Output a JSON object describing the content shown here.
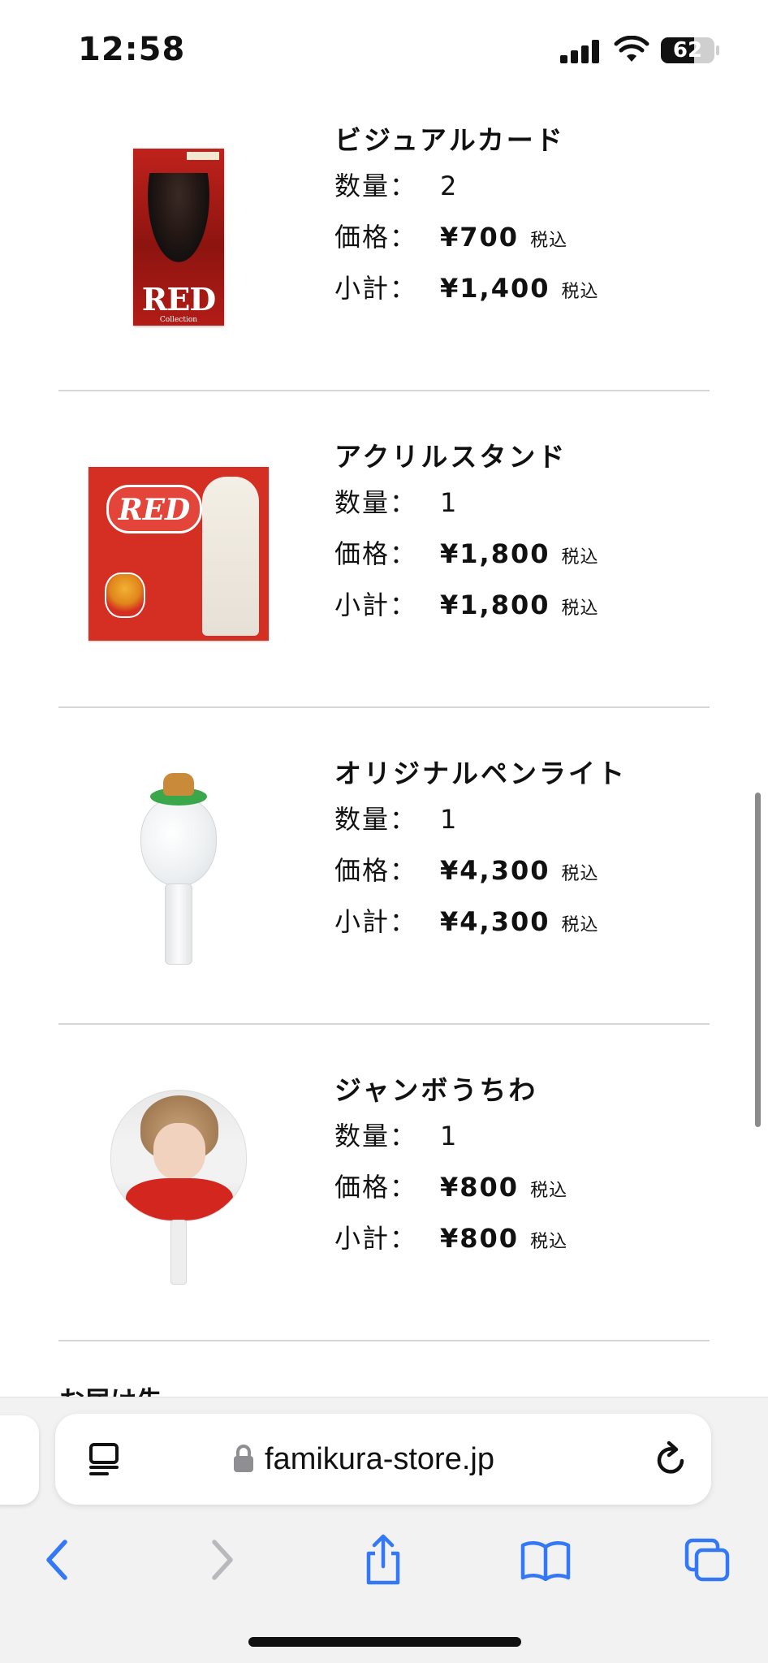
{
  "status_bar": {
    "time": "12:58",
    "battery": "62",
    "battery_level": 0.62,
    "icons": [
      "signal-icon",
      "wifi-icon",
      "battery-icon"
    ]
  },
  "labels": {
    "quantity": "数量：",
    "price": "価格：",
    "subtotal": "小計：",
    "tax_included": "税込"
  },
  "cart": {
    "items": [
      {
        "name": "ビジュアルカード",
        "quantity": "2",
        "price": "¥700",
        "subtotal": "¥1,400",
        "image": {
          "title": "RED",
          "subtitle": "Collection"
        }
      },
      {
        "name": "アクリルスタンド",
        "quantity": "1",
        "price": "¥1,800",
        "subtotal": "¥1,800",
        "image": {
          "title": "RED"
        }
      },
      {
        "name": "オリジナルペンライト",
        "quantity": "1",
        "price": "¥4,300",
        "subtotal": "¥4,300"
      },
      {
        "name": "ジャンボうちわ",
        "quantity": "1",
        "price": "¥800",
        "subtotal": "¥800"
      }
    ],
    "next_section_heading_partial": "お届け先"
  },
  "browser": {
    "url": "famikura-store.jp",
    "icons": {
      "reader": "reader-icon",
      "lock": "lock-icon",
      "reload": "reload-icon",
      "back": "back-icon",
      "forward": "forward-icon",
      "share": "share-icon",
      "bookmarks": "bookmarks-icon",
      "tabs": "tabs-icon"
    },
    "accent_color": "#3478f6",
    "disabled_color": "#b8b8bd"
  }
}
